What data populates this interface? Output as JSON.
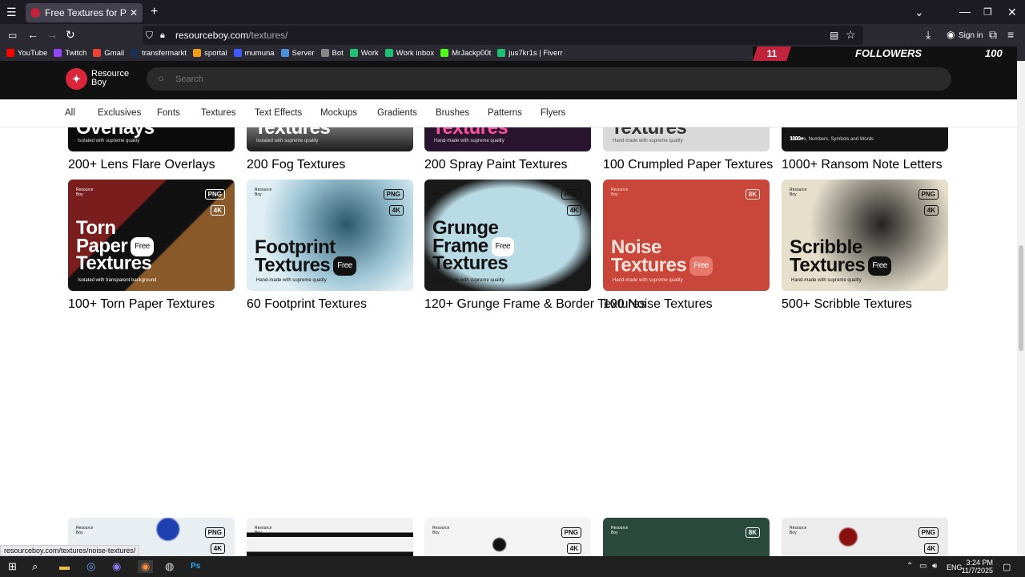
{
  "browser": {
    "tab_title": "Free Textures for Photoshop - R",
    "url_host": "resourceboy.com",
    "url_path": "/textures/",
    "sign_in": "Sign in",
    "bookmarks": [
      {
        "label": "YouTube",
        "color": "#ff0000"
      },
      {
        "label": "Twitch",
        "color": "#9146ff"
      },
      {
        "label": "Gmail",
        "color": "#ea4335"
      },
      {
        "label": "transfermarkt",
        "color": "#1a3151"
      },
      {
        "label": "sportal",
        "color": "#f39c12"
      },
      {
        "label": "mumuna",
        "color": "#3d5afe"
      },
      {
        "label": "Server",
        "color": "#4a90d9"
      },
      {
        "label": "Bot",
        "color": "#888888"
      },
      {
        "label": "Work",
        "color": "#1dbf73"
      },
      {
        "label": "Work inbox",
        "color": "#1dbf73"
      },
      {
        "label": "MrJackp00t",
        "color": "#53fc18"
      },
      {
        "label": "jus7kr1s | Fiverr",
        "color": "#1dbf73"
      }
    ]
  },
  "banner": {
    "count_left": "11",
    "followers": "FOLLOWERS",
    "count_right": "100"
  },
  "site": {
    "logo_line1": "Resource",
    "logo_line2": "Boy",
    "search_placeholder": "Search",
    "categories": [
      "All",
      "Exclusives",
      "Fonts",
      "Textures",
      "Text Effects",
      "Mockups",
      "Gradients",
      "Brushes",
      "Patterns",
      "Flyers"
    ]
  },
  "row1": [
    {
      "label": "200+ Lens Flare Overlays",
      "title": "Overlays",
      "sub": "Isolated with supreme quality"
    },
    {
      "label": "200 Fog Textures",
      "title": "Textures",
      "sub": "Isolated with supreme quality"
    },
    {
      "label": "200 Spray Paint Textures",
      "title": "Textures",
      "sub": "Hand-made with supreme quality"
    },
    {
      "label": "100 Crumpled Paper Textures",
      "title": "Textures",
      "sub": "Hand-made with supreme quality"
    },
    {
      "label": "1000+ Ransom Note Letters",
      "title": "1000+",
      "sub": "Letters, Numbers, Symbols and Words"
    }
  ],
  "row2": [
    {
      "label": "100+ Torn Paper Textures",
      "line1": "Torn",
      "line2": "Paper",
      "line3": "Textures",
      "free": "Free",
      "sub": "Isolated with transparent background",
      "tags": [
        "PNG",
        "4K"
      ]
    },
    {
      "label": "60 Footprint Textures",
      "line1": "Footprint",
      "line2": "Textures",
      "free": "Free",
      "sub": "Hand-made with supreme quality",
      "tags": [
        "PNG",
        "4K"
      ]
    },
    {
      "label": "120+ Grunge Frame & Border Textures",
      "line1": "Grunge",
      "line2": "Frame",
      "line3": "Textures",
      "free": "Free",
      "sub": "Hand-made with supreme quality",
      "tags": [
        "PNG",
        "4K"
      ]
    },
    {
      "label": "100 Noise Textures",
      "line1": "Noise",
      "line2": "Textures",
      "free": "Free",
      "sub": "Hand-made with supreme quality",
      "tags": [
        "8K"
      ]
    },
    {
      "label": "500+ Scribble Textures",
      "line1": "Scribble",
      "line2": "Textures",
      "free": "Free",
      "sub": "Hand-made with supreme quality",
      "tags": [
        "PNG",
        "4K"
      ]
    }
  ],
  "row3_tags": [
    [
      "PNG",
      "4K"
    ],
    [],
    [
      "PNG",
      "4K"
    ],
    [
      "8K"
    ],
    [
      "PNG",
      "4K"
    ]
  ],
  "brand_small": "Resource\nBoy",
  "status_url": "resourceboy.com/textures/noise-textures/",
  "taskbar": {
    "lang": "ENG",
    "time": "3:24 PM",
    "date": "11/7/2025"
  }
}
